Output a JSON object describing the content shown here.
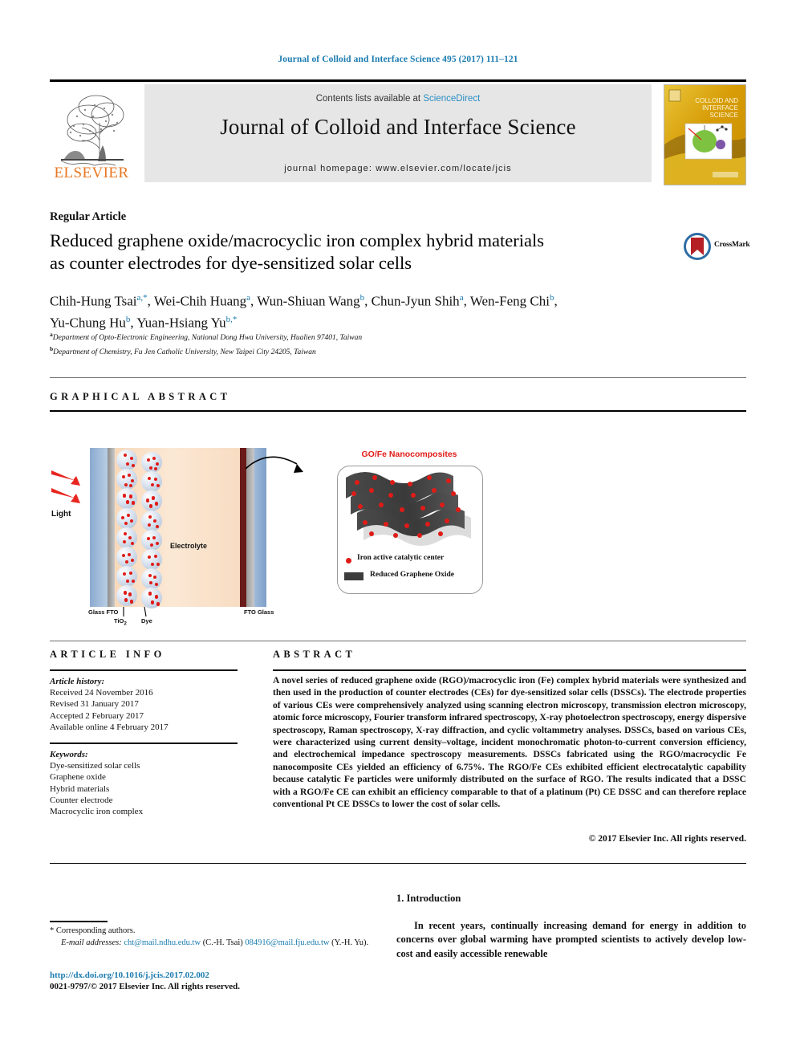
{
  "running_head": "Journal of Colloid and Interface Science 495 (2017) 111–121",
  "masthead": {
    "publisher": "ELSEVIER",
    "contents_prefix": "Contents lists available at ",
    "sciencedirect": "ScienceDirect",
    "journal_title": "Journal of Colloid and Interface Science",
    "homepage": "journal homepage: www.elsevier.com/locate/jcis",
    "cover_line1": "COLLOID AND",
    "cover_line2": "INTERFACE",
    "cover_line3": "SCIENCE",
    "link_color": "#2a8ec4",
    "band_color": "#e6e6e6",
    "elsevier_orange": "#E87722"
  },
  "article": {
    "type": "Regular Article",
    "title_line1": "Reduced graphene oxide/macrocyclic iron complex hybrid materials",
    "title_line2": "as counter electrodes for dye-sensitized solar cells",
    "crossmark_label": "CrossMark",
    "authors_line1": "Chih-Hung Tsai a,*, Wei-Chih Huang a, Wun-Shiuan Wang b, Chun-Jyun Shih a, Wen-Feng Chi b,",
    "authors_line2": "Yu-Chung Hu b, Yuan-Hsiang Yu b,*",
    "authors": [
      {
        "name": "Chih-Hung Tsai",
        "sup": "a,*"
      },
      {
        "name": "Wei-Chih Huang",
        "sup": "a"
      },
      {
        "name": "Wun-Shiuan Wang",
        "sup": "b"
      },
      {
        "name": "Chun-Jyun Shih",
        "sup": "a"
      },
      {
        "name": "Wen-Feng Chi",
        "sup": "b"
      },
      {
        "name": "Yu-Chung Hu",
        "sup": "b"
      },
      {
        "name": "Yuan-Hsiang Yu",
        "sup": "b,*"
      }
    ],
    "affiliations": [
      {
        "marker": "a",
        "text": "Department of Opto-Electronic Engineering, National Dong Hwa University, Hualien 97401, Taiwan"
      },
      {
        "marker": "b",
        "text": "Department of Chemistry, Fu Jen Catholic University, New Taipei City 24205, Taiwan"
      }
    ]
  },
  "graphical_abstract": {
    "heading": "GRAPHICAL ABSTRACT",
    "labels": {
      "light": "Light",
      "electrolyte": "Electrolyte",
      "glass_fto": "Glass FTO",
      "tio2": "TiO",
      "tio2_sub": "2",
      "dye": "Dye",
      "fto_glass": "FTO Glass",
      "nano_title": "GO/Fe Nanocomposites",
      "legend_iron": "Iron active catalytic center",
      "legend_rgo": "Reduced Graphene  Oxide"
    },
    "colors": {
      "iron_red": "#e01b17",
      "rgo_gray": "#3c3c3c",
      "electrolyte": "#fbe8d4",
      "glass_blue": "#8aa9cf",
      "counter_electrode": "#6a1a18"
    }
  },
  "article_info": {
    "heading": "ARTICLE INFO",
    "history_label": "Article history:",
    "history": [
      "Received 24 November 2016",
      "Revised 31 January 2017",
      "Accepted 2 February 2017",
      "Available online 4 February 2017"
    ],
    "keywords_label": "Keywords:",
    "keywords": [
      "Dye-sensitized solar cells",
      "Graphene oxide",
      "Hybrid materials",
      "Counter electrode",
      "Macrocyclic iron complex"
    ]
  },
  "abstract": {
    "heading": "ABSTRACT",
    "body": "A novel series of reduced graphene oxide (RGO)/macrocyclic iron (Fe) complex hybrid materials were synthesized and then used in the production of counter electrodes (CEs) for dye-sensitized solar cells (DSSCs). The electrode properties of various CEs were comprehensively analyzed using scanning electron microscopy, transmission electron microscopy, atomic force microscopy, Fourier transform infrared spectroscopy, X-ray photoelectron spectroscopy, energy dispersive spectroscopy, Raman spectroscopy, X-ray diffraction, and cyclic voltammetry analyses. DSSCs, based on various CEs, were characterized using current density–voltage, incident monochromatic photon-to-current conversion efficiency, and electrochemical impedance spectroscopy measurements. DSSCs fabricated using the RGO/macrocyclic Fe nanocomposite CEs yielded an efficiency of 6.75%. The RGO/Fe CEs exhibited efficient electrocatalytic capability because catalytic Fe particles were uniformly distributed on the surface of RGO. The results indicated that a DSSC with a RGO/Fe CE can exhibit an efficiency comparable to that of a platinum (Pt) CE DSSC and can therefore replace conventional Pt CE DSSCs to lower the cost of solar cells.",
    "copyright": "© 2017 Elsevier Inc. All rights reserved."
  },
  "footer": {
    "corresponding_marker": "*",
    "corresponding_label": "Corresponding authors.",
    "email_label": "E-mail addresses:",
    "email1": "cht@mail.ndhu.edu.tw",
    "email1_owner": "(C.-H. Tsai)",
    "email2": "084916@mail.fju.edu.tw",
    "email2_owner": "(Y.-H. Yu).",
    "doi": "http://dx.doi.org/10.1016/j.jcis.2017.02.002",
    "issn": "0021-9797/© 2017 Elsevier Inc. All rights reserved.",
    "link_color": "#1a7bb0"
  },
  "introduction": {
    "heading": "1. Introduction",
    "body": "In recent years, continually increasing demand for energy in addition to concerns over global warming have prompted scientists to actively develop low-cost and easily accessible renewable"
  }
}
